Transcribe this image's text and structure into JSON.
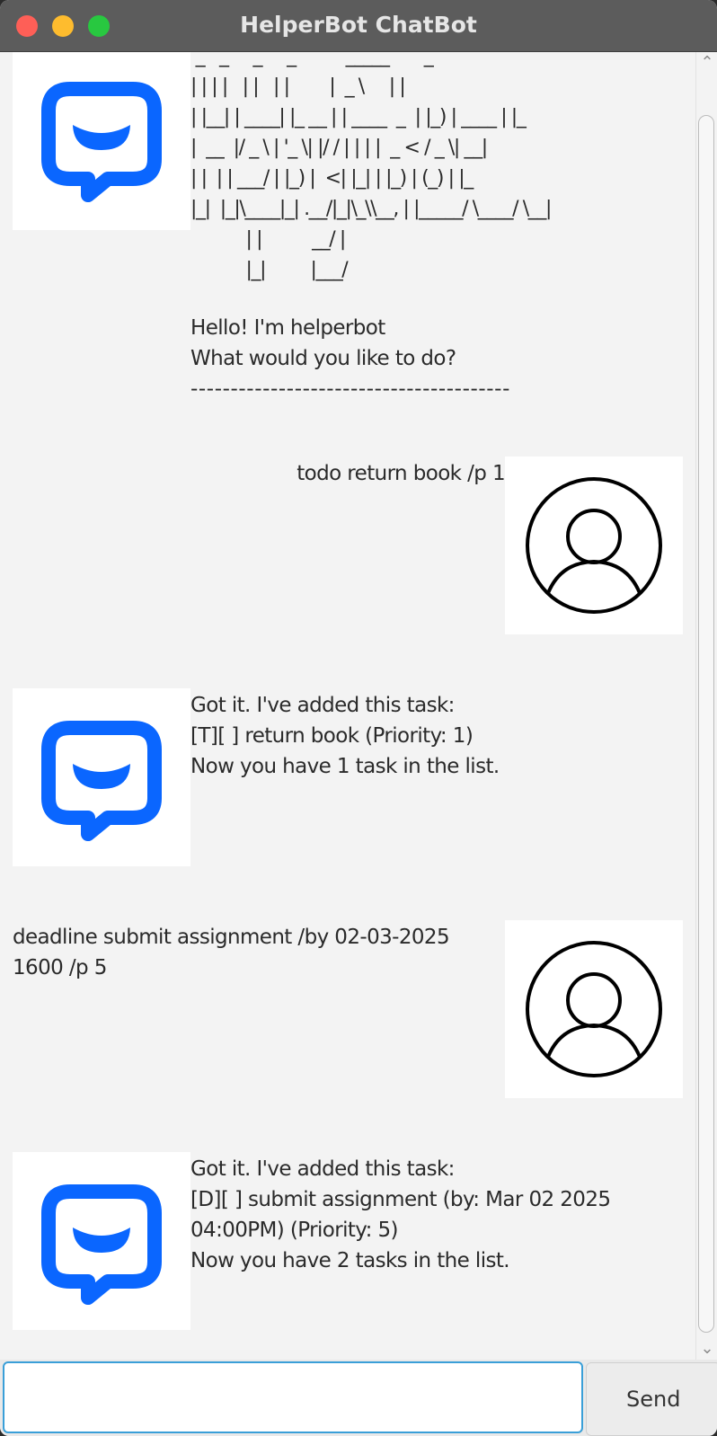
{
  "window": {
    "title": "HelperBot ChatBot",
    "traffic_colors": {
      "close": "#fe5f57",
      "minimize": "#febc2e",
      "maximize": "#28c840"
    }
  },
  "colors": {
    "bot_icon": "#0a66ff",
    "background": "#f3f3f3",
    "input_focus": "#3a9fd8"
  },
  "icons": {
    "bot": "chat-bubble-icon",
    "user": "user-profile-icon"
  },
  "chat": {
    "messages": [
      {
        "sender": "bot",
        "ascii": [
          " _   _     _     _          _____       _",
          "| | | |   | |   | |        |  _ \\     | |",
          "| |__| | ____| |_ __ | | ____  _  | |_) | ____ | |_",
          "|  __  |/ _ \\ | '_ \\| |/ / | | | |  _ < / _ \\| __|",
          "| |  | | ___/ | |_) |  <| |_| | |_) | (_) | |_",
          "|_|  |_|\\____|_| .__/|_|\\_\\\\__, | |_____/ \\____/ \\__|",
          "           | |          __/ |",
          "           |_|         |___/"
        ],
        "lines": [
          "Hello! I'm helperbot",
          "What would you like to do?",
          "----------------------------------------"
        ]
      },
      {
        "sender": "user",
        "text": "todo return book /p 1"
      },
      {
        "sender": "bot",
        "lines": [
          "Got it. I've added this task:",
          "[T][ ] return book (Priority: 1)",
          "Now you have 1 task in the list."
        ]
      },
      {
        "sender": "user",
        "text": "deadline submit assignment /by 02-03-2025\n1600 /p 5"
      },
      {
        "sender": "bot",
        "lines": [
          "Got it. I've added this task:",
          "[D][ ] submit assignment (by: Mar 02 2025\n04:00PM) (Priority: 5)",
          "Now you have 2 tasks in the list."
        ]
      }
    ]
  },
  "input": {
    "value": "",
    "placeholder": "",
    "send_label": "Send"
  }
}
